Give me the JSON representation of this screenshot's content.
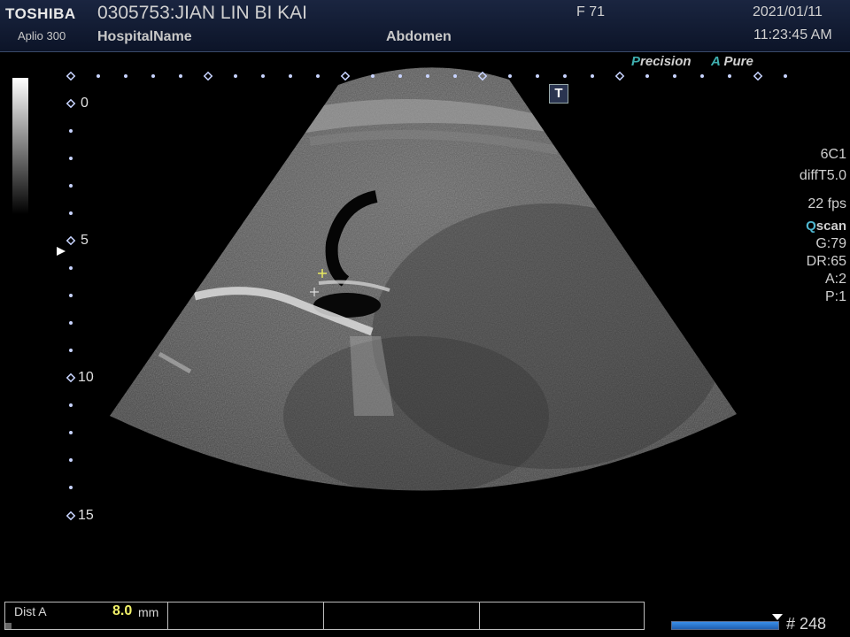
{
  "header": {
    "brand": "TOSHIBA",
    "model": "Aplio 300",
    "patient": "0305753:JIAN LIN BI KAI",
    "hospital": "HospitalName",
    "exam": "Abdomen",
    "frame_label": "F  71",
    "date": "2021/01/11",
    "time": "11:23:45 AM"
  },
  "badges": {
    "precision_initial": "P",
    "precision_rest": "recision",
    "apure_initial": "A",
    "apure_rest": "Pure"
  },
  "right_panel": {
    "probe": "6C1",
    "mode": "diffT5.0",
    "fps": "22 fps",
    "qscan_q": "Q",
    "qscan_rest": "scan",
    "gain": "G:79",
    "dr": "DR:65",
    "a": "A:2",
    "p": "P:1"
  },
  "depth_scale": {
    "labels": [
      "0",
      "5",
      "10",
      "15"
    ]
  },
  "t_marker": "T",
  "measurement": {
    "label": "Dist A",
    "value": "8.0",
    "unit": "mm"
  },
  "frame_counter": "# 248",
  "colors": {
    "header_bg": "#0c1428",
    "accent_teal": "#3fb0b0",
    "measure_yellow": "#f2f26a",
    "frame_bar": "#3a8ee8"
  }
}
